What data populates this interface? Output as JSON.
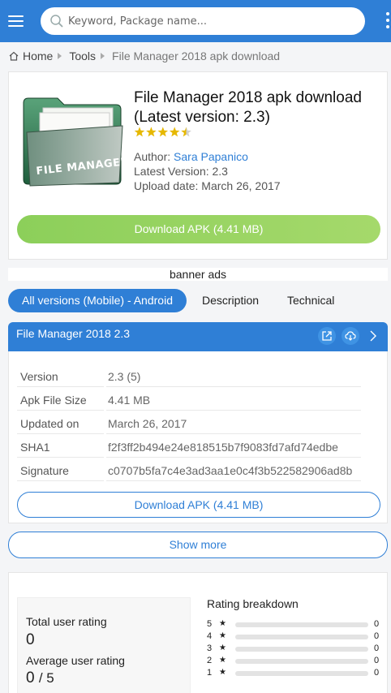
{
  "header": {
    "search_placeholder": "Keyword, Package name...",
    "accent_color": "#2f7fd6"
  },
  "breadcrumb": [
    "Home",
    "Tools",
    "File Manager 2018 apk download"
  ],
  "app": {
    "title": "File Manager 2018 apk download (Latest version: 2.3)",
    "rating_stars": 4.5,
    "author_label": "Author:",
    "author_name": "Sara Papanico",
    "latest_version": "Latest Version: 2.3",
    "upload_date": "Upload date: March 26, 2017",
    "download_label": "Download APK (4.41 MB)",
    "icon_text": "FILE MANAGER"
  },
  "banner": "banner ads",
  "tabs": [
    "All versions (Mobile) - Android",
    "Description",
    "Technical"
  ],
  "version": {
    "name": "File Manager 2018 2.3",
    "details": [
      {
        "key": "Version",
        "value": "2.3 (5)"
      },
      {
        "key": "Apk File Size",
        "value": "4.41 MB"
      },
      {
        "key": "Updated on",
        "value": "March 26, 2017"
      },
      {
        "key": "SHA1",
        "value": "f2f3ff2b494e24e818515b7f9083fd7afd74edbe"
      },
      {
        "key": "Signature",
        "value": "c0707b5fa7c4e3ad3aa1e0c4f3b522582906ad8b"
      }
    ],
    "download_label": "Download APK (4.41 MB)"
  },
  "show_more": "Show more",
  "rating": {
    "total_label": "Total user rating",
    "total_value": "0",
    "average_label": "Average user rating",
    "average_value": "0",
    "average_suffix": "/ 5",
    "breakdown_title": "Rating breakdown",
    "star_glyph": "★",
    "breakdown": [
      {
        "stars": "5",
        "count": "0"
      },
      {
        "stars": "4",
        "count": "0"
      },
      {
        "stars": "3",
        "count": "0"
      },
      {
        "stars": "2",
        "count": "0"
      },
      {
        "stars": "1",
        "count": "0"
      }
    ]
  }
}
